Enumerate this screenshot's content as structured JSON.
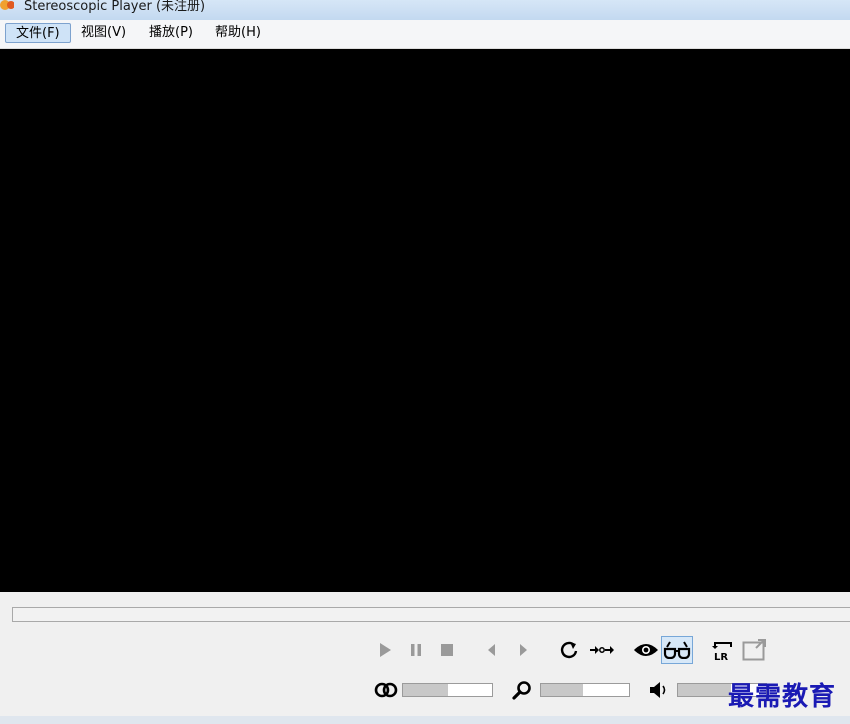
{
  "window": {
    "title": "Stereoscopic Player (未注册)"
  },
  "menu": {
    "items": [
      {
        "label": "文件(F)",
        "active": true
      },
      {
        "label": "视图(V)",
        "active": false
      },
      {
        "label": "播放(P)",
        "active": false
      },
      {
        "label": "帮助(H)",
        "active": false
      }
    ]
  },
  "controls": {
    "icons": [
      "play-icon",
      "pause-icon",
      "stop-icon",
      "previous-icon",
      "next-icon",
      "repeat-icon",
      "sync-icon",
      "eye-icon",
      "glasses-icon",
      "swap-lr-icon",
      "fullscreen-icon",
      "parallax-icon",
      "zoom-icon",
      "volume-icon"
    ],
    "glasses_pressed": true,
    "swap_label": "LR",
    "parallax_level": 0.5,
    "zoom_level": 0.48,
    "volume_level": 0.6
  },
  "watermark": {
    "text": "最需教育"
  }
}
